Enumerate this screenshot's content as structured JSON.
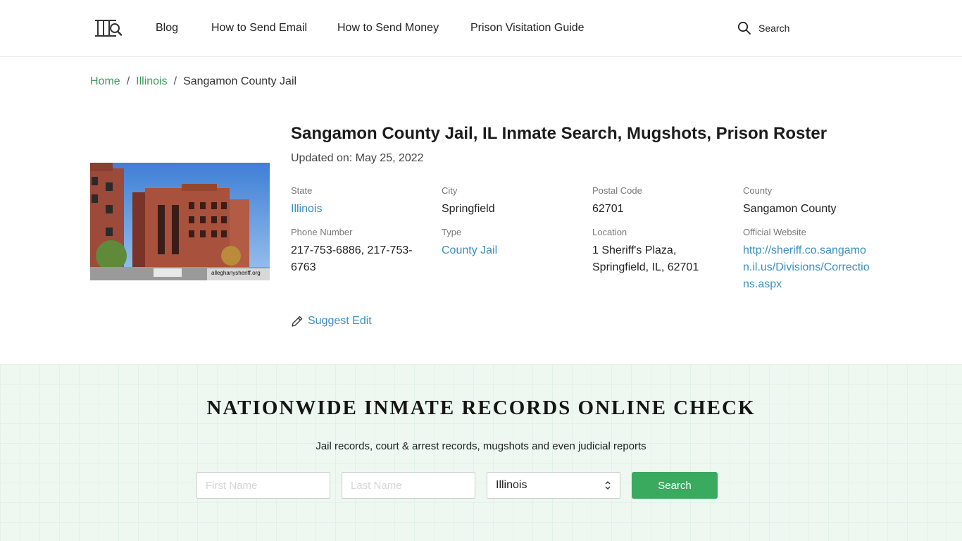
{
  "header": {
    "logo_icon": "jail-bars-magnifier-icon",
    "nav": [
      "Blog",
      "How to Send Email",
      "How to Send Money",
      "Prison Visitation Guide"
    ],
    "search_label": "Search",
    "search_icon": "search-icon"
  },
  "breadcrumb": {
    "items": [
      "Home",
      "Illinois",
      "Sangamon County Jail"
    ],
    "separator": "/"
  },
  "facility": {
    "title": "Sangamon County Jail, IL Inmate Search, Mugshots, Prison Roster",
    "updated": "Updated on: May 25, 2022",
    "photo_watermark": "alleghanysheriff.org",
    "fields": [
      {
        "label": "State",
        "value": "Illinois"
      },
      {
        "label": "City",
        "value": "Springfield"
      },
      {
        "label": "Postal Code",
        "value": "62701"
      },
      {
        "label": "County",
        "value": "Sangamon County"
      },
      {
        "label": "Phone Number",
        "value": "217-753-6886, 217-753-6763"
      },
      {
        "label": "Type",
        "value": "County Jail"
      },
      {
        "label": "Location",
        "value": "1 Sheriff's Plaza, Springfield, IL, 62701"
      },
      {
        "label": "Official Website",
        "value": "http://sheriff.co.sangamon.il.us/Divisions/Corrections.aspx"
      }
    ],
    "suggest_edit": "Suggest Edit"
  },
  "search_band": {
    "title": "NATIONWIDE INMATE RECORDS ONLINE CHECK",
    "subtitle": "Jail records, court & arrest records, mugshots and even judicial reports",
    "first_name_placeholder": "First Name",
    "last_name_placeholder": "Last Name",
    "state_selected": "Illinois",
    "button": "Search"
  },
  "colors": {
    "link_green": "#3c9a5f",
    "link_blue": "#3b8fc0",
    "button_green": "#3aaa5f",
    "band_bg": "#eef8f1"
  }
}
